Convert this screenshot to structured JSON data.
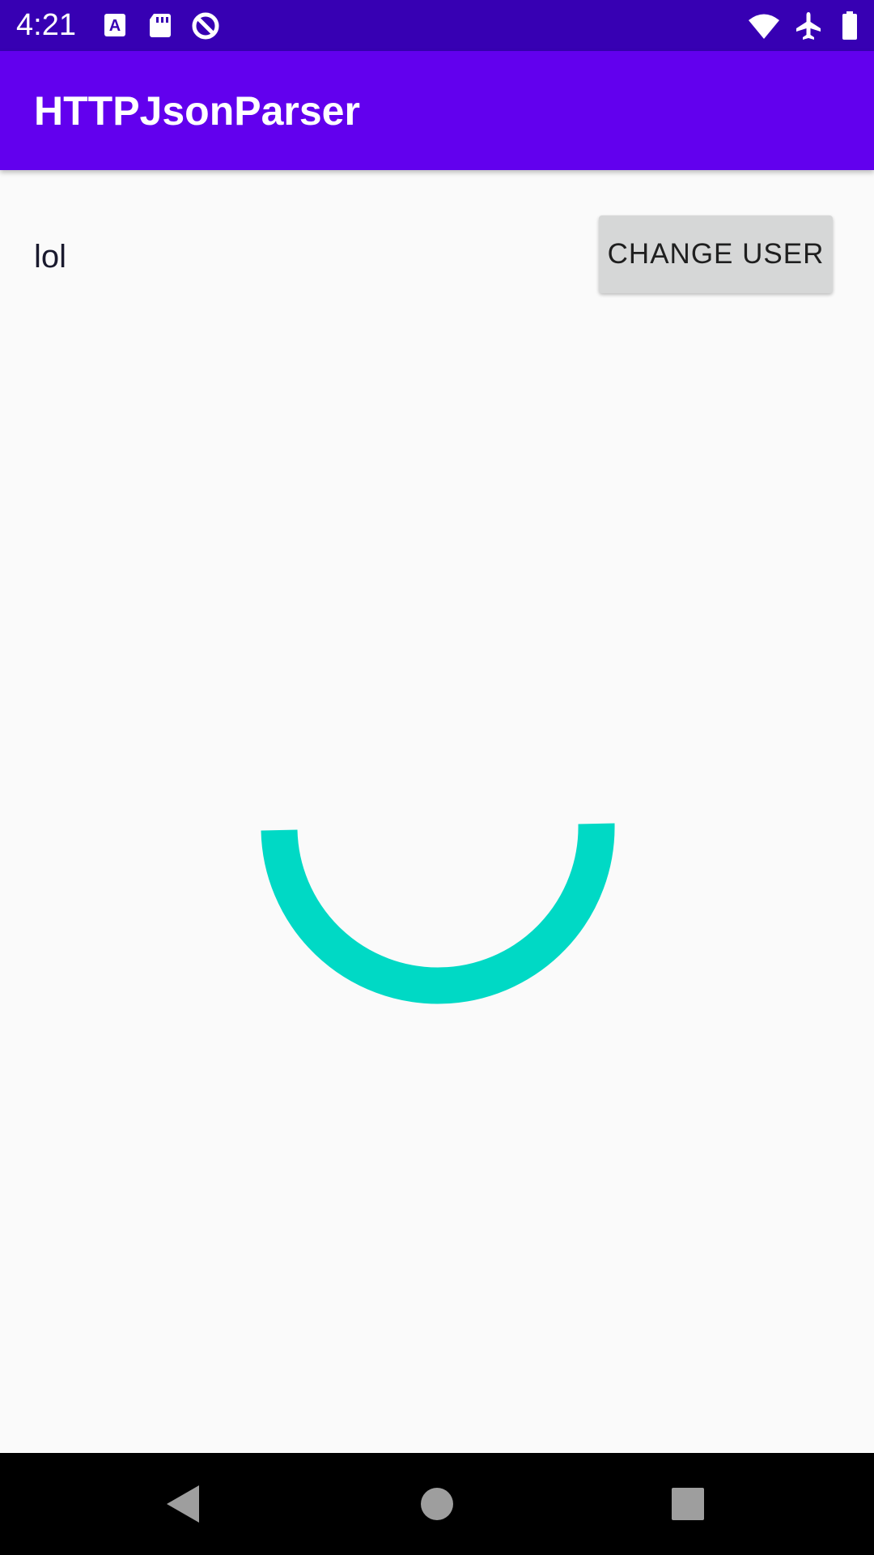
{
  "status_bar": {
    "time": "4:21",
    "background": "#3700b3",
    "left_icons": [
      "text-a-notification-icon",
      "sd-card-icon",
      "data-saver-icon"
    ],
    "right_icons": [
      "wifi-icon",
      "airplane-mode-icon",
      "battery-icon"
    ]
  },
  "app_bar": {
    "title": "HTTPJsonParser",
    "background": "#6200ee"
  },
  "content": {
    "user_text": "lol",
    "change_user_label": "CHANGE USER"
  },
  "progress": {
    "type": "indeterminate-circular-spinner",
    "color": "#00d9c5"
  },
  "nav_bar": {
    "buttons": [
      "back-icon",
      "home-icon",
      "recents-icon"
    ],
    "background": "#000000"
  }
}
